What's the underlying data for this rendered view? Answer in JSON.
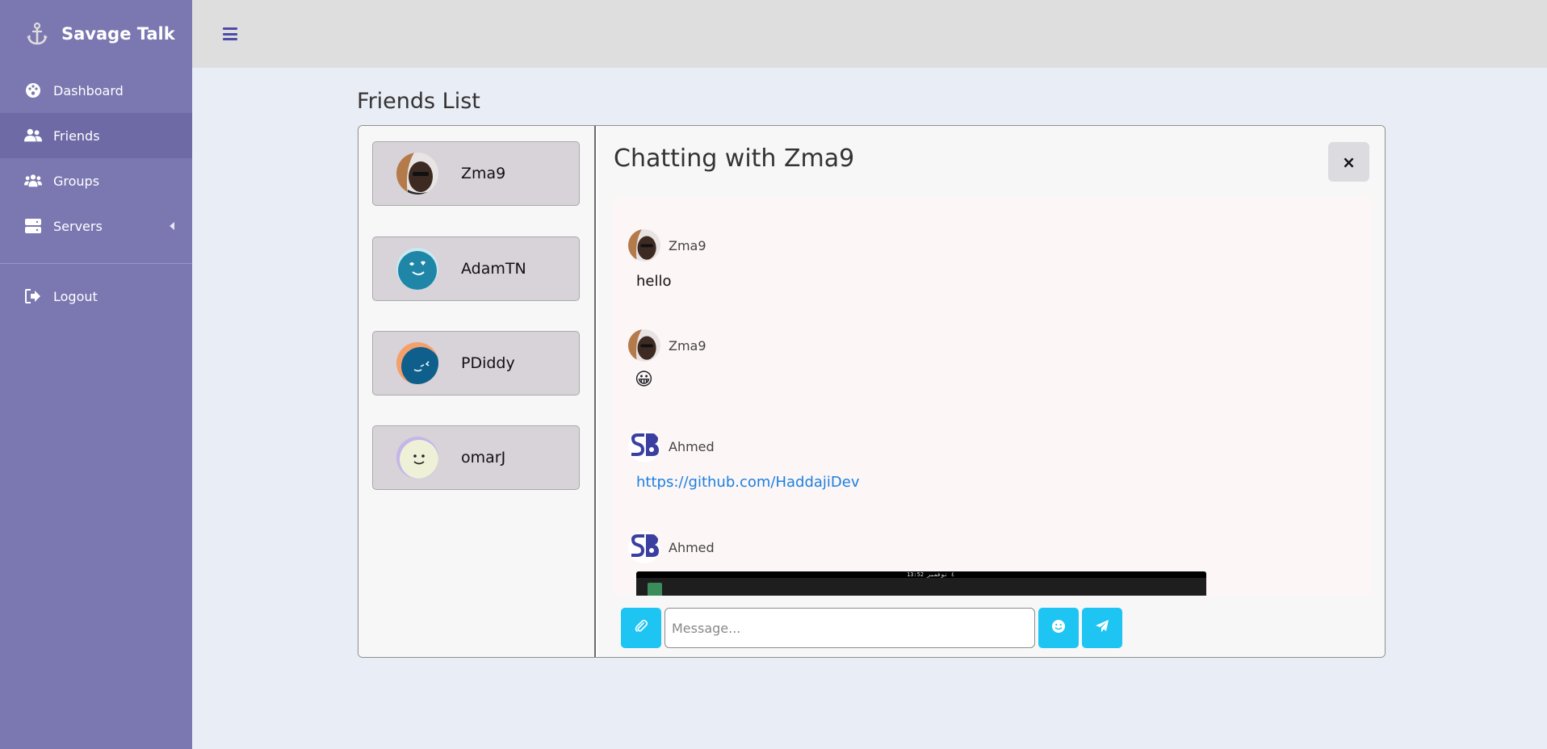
{
  "app": {
    "brand_name": "Savage Talk",
    "brand_icon": "anchor-icon"
  },
  "sidebar": {
    "items": [
      {
        "label": "Dashboard",
        "icon": "palette-icon"
      },
      {
        "label": "Friends",
        "icon": "user-friends-icon",
        "active": true
      },
      {
        "label": "Groups",
        "icon": "users-icon"
      },
      {
        "label": "Servers",
        "icon": "server-icon",
        "has_submenu": true
      }
    ],
    "logout_label": "Logout"
  },
  "main": {
    "title": "Friends List"
  },
  "friends": [
    {
      "name": "Zma9"
    },
    {
      "name": "AdamTN"
    },
    {
      "name": "PDiddy"
    },
    {
      "name": "omarJ"
    }
  ],
  "chat": {
    "title": "Chatting with Zma9",
    "close_label": "×",
    "messages": [
      {
        "sender": "Zma9",
        "type": "text",
        "text": "hello"
      },
      {
        "sender": "Zma9",
        "type": "emoji",
        "text": "😀"
      },
      {
        "sender": "Ahmed",
        "type": "link",
        "text": "https://github.com/HaddajiDev"
      },
      {
        "sender": "Ahmed",
        "type": "image",
        "image_caption": "13:52 ٤ نوفمبر"
      }
    ],
    "input_placeholder": "Message..."
  },
  "colors": {
    "sidebar": "#7b77b1",
    "topbar": "#dedede",
    "accent": "#1ec5f3",
    "link": "#1c7fe0"
  }
}
